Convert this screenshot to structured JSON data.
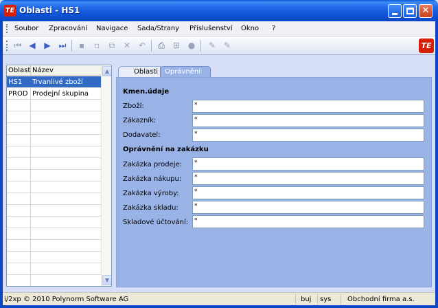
{
  "window": {
    "title": "Oblasti - HS1",
    "logo_text": "TE"
  },
  "menu": [
    "Soubor",
    "Zpracování",
    "Navigace",
    "Sada/Strany",
    "Příslušenství",
    "Okno",
    "?"
  ],
  "grid": {
    "columns": [
      "Oblast",
      "Název"
    ],
    "rows": [
      {
        "code": "HS1",
        "name": "Trvanlivé zboží"
      },
      {
        "code": "PROD",
        "name": "Prodejní skupina"
      }
    ]
  },
  "tabs": [
    "Oblasti",
    "Oprávnění"
  ],
  "form": {
    "section1": "Kmen.údaje",
    "zbozi_label": "Zboží:",
    "zbozi_value": "*",
    "zakaznik_label": "Zákazník:",
    "zakaznik_value": "*",
    "dodavatel_label": "Dodavatel:",
    "dodavatel_value": "*",
    "section2": "Oprávnění na zakázku",
    "prodeje_label": "Zakázka prodeje:",
    "prodeje_value": "*",
    "nakupu_label": "Zakázka nákupu:",
    "nakupu_value": "*",
    "vyroby_label": "Zakázka výroby:",
    "vyroby_value": "*",
    "skladu_label": "Zakázka skladu:",
    "skladu_value": "*",
    "uctovani_label": "Skladové účtování:",
    "uctovani_value": "*"
  },
  "status": {
    "copyright": "i/2xp © 2010 Polynorm Software AG",
    "user1": "buj",
    "user2": "sys",
    "company": "Obchodní firma a.s."
  },
  "colors": {
    "title_bar": "#0a5bd8",
    "selection": "#316ac5",
    "tab_pane": "#9ab3e6",
    "logo_red": "#d81e05"
  }
}
